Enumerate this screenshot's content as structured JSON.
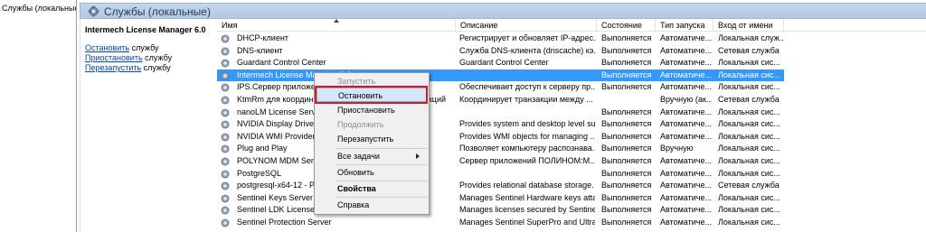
{
  "tree": {
    "item": "Службы (локальные)"
  },
  "banner": {
    "title": "Службы (локальные)"
  },
  "ext": {
    "service_title": "Intermech License Manager 6.0",
    "actions": [
      {
        "link": "Остановить",
        "rest": " службу"
      },
      {
        "link": "Приостановить",
        "rest": " службу"
      },
      {
        "link": "Перезапустить",
        "rest": " службу"
      }
    ]
  },
  "columns": {
    "name": "Имя",
    "description": "Описание",
    "status": "Состояние",
    "startup": "Тип запуска",
    "logon": "Вход от имени"
  },
  "rows": [
    {
      "name": "DHCP-клиент",
      "desc": "Регистрирует и обновляет IP-адрес...",
      "status": "Выполняется",
      "startup": "Автоматиче...",
      "logon": "Локальная служ..."
    },
    {
      "name": "DNS-клиент",
      "desc": "Служба DNS-клиента (dnscache) кэ...",
      "status": "Выполняется",
      "startup": "Автоматиче...",
      "logon": "Сетевая служба"
    },
    {
      "name": "Guardant Control Center",
      "desc": "Guardant Control Center",
      "status": "Выполняется",
      "startup": "Автоматиче...",
      "logon": "Локальная сис..."
    },
    {
      "name": "Intermech License Manager 6.0",
      "desc": "",
      "status": "Выполняется",
      "startup": "Автоматиче...",
      "logon": "Локальная сис..."
    },
    {
      "name": "IPS.Сервер приложений",
      "desc": "Обеспечивает доступ к серверу пр...",
      "status": "Выполняется",
      "startup": "Автоматиче...",
      "logon": "Локальная сис..."
    },
    {
      "name": "KtmRm для координатора распределенных транзакций",
      "desc": "Координирует транзакции между ...",
      "status": "",
      "startup": "Вручную (ак...",
      "logon": "Сетевая служба"
    },
    {
      "name": "nanoLM License Server",
      "desc": "",
      "status": "Выполняется",
      "startup": "Автоматиче...",
      "logon": "Локальная сис..."
    },
    {
      "name": "NVIDIA Display Driver Service",
      "desc": "Provides system and desktop level su...",
      "status": "Выполняется",
      "startup": "Автоматиче...",
      "logon": "Локальная сис..."
    },
    {
      "name": "NVIDIA WMI Provider",
      "desc": "Provides WMI objects for managing ...",
      "status": "Выполняется",
      "startup": "Автоматиче...",
      "logon": "Локальная сис..."
    },
    {
      "name": "Plug and Play",
      "desc": "Позволяет компьютеру распознава...",
      "status": "Выполняется",
      "startup": "Вручную",
      "logon": "Локальная сис..."
    },
    {
      "name": "POLYNOM MDM Service",
      "desc": "Сервер приложений ПОЛИНОМ:М...",
      "status": "Выполняется",
      "startup": "Автоматиче...",
      "logon": "Локальная сис..."
    },
    {
      "name": "PostgreSQL",
      "desc": "",
      "status": "Выполняется",
      "startup": "Автоматиче...",
      "logon": "Локальная сис..."
    },
    {
      "name": "postgresql-x64-12 - PostgreSQL Server 12",
      "desc": "Provides relational database storage.",
      "status": "Выполняется",
      "startup": "Автоматиче...",
      "logon": "Сетевая служба"
    },
    {
      "name": "Sentinel Keys Server",
      "desc": "Manages Sentinel Hardware keys atta...",
      "status": "Выполняется",
      "startup": "Автоматиче...",
      "logon": "Локальная сис..."
    },
    {
      "name": "Sentinel LDK License Manager",
      "desc": "Manages licenses secured by Sentinel...",
      "status": "Выполняется",
      "startup": "Автоматиче...",
      "logon": "Локальная сис..."
    },
    {
      "name": "Sentinel Protection Server",
      "desc": "Manages Sentinel SuperPro and Ultra...",
      "status": "Выполняется",
      "startup": "Автоматиче...",
      "logon": "Локальная сис..."
    }
  ],
  "menu": {
    "start": "Запустить",
    "stop": "Остановить",
    "pause": "Приостановить",
    "resume": "Продолжить",
    "restart": "Перезапустить",
    "all_tasks": "Все задачи",
    "refresh": "Обновить",
    "properties": "Свойства",
    "help": "Справка"
  },
  "colors": {
    "selection": "#3399ff",
    "highlight_frame": "#e0141a",
    "banner": "#c3d6ea"
  }
}
